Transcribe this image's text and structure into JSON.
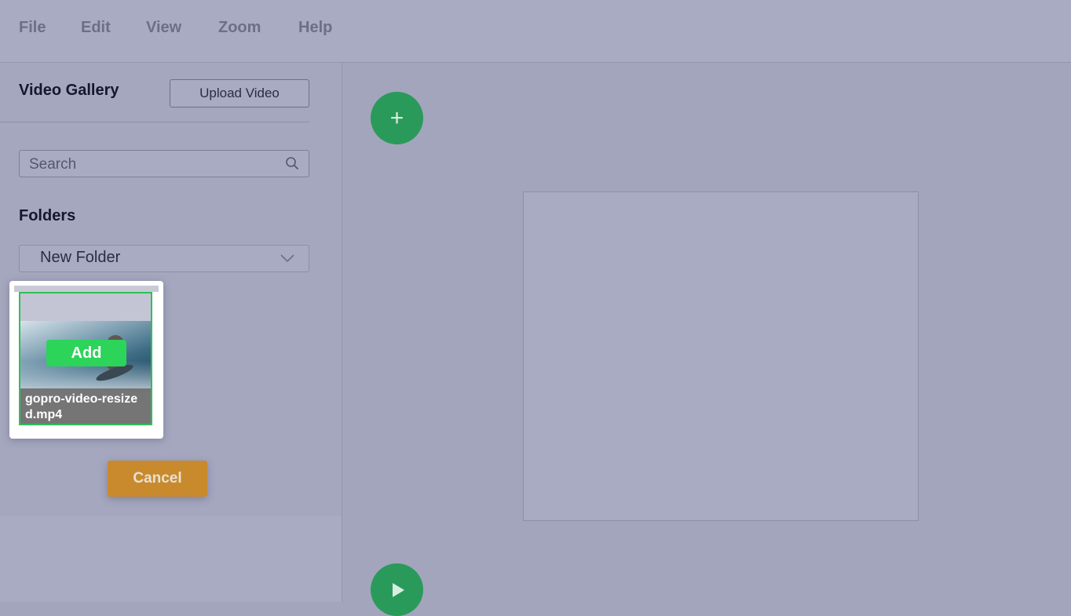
{
  "menu": {
    "items": [
      "File",
      "Edit",
      "View",
      "Zoom",
      "Help"
    ]
  },
  "sidebar": {
    "title": "Video Gallery",
    "upload_label": "Upload Video",
    "search": {
      "placeholder": "Search",
      "value": ""
    },
    "folders_title": "Folders",
    "folder_selected": "New Folder",
    "video": {
      "filename": "gopro-video-resized.mp4",
      "add_label": "Add"
    },
    "cancel_label": "Cancel"
  },
  "main": {
    "add_icon": "+",
    "add_icon_name": "plus-icon",
    "play_icon_name": "play-icon"
  },
  "colors": {
    "accent_green": "#2a9a5a",
    "add_green": "#2cd45a",
    "cancel_orange": "#c98a2d"
  }
}
